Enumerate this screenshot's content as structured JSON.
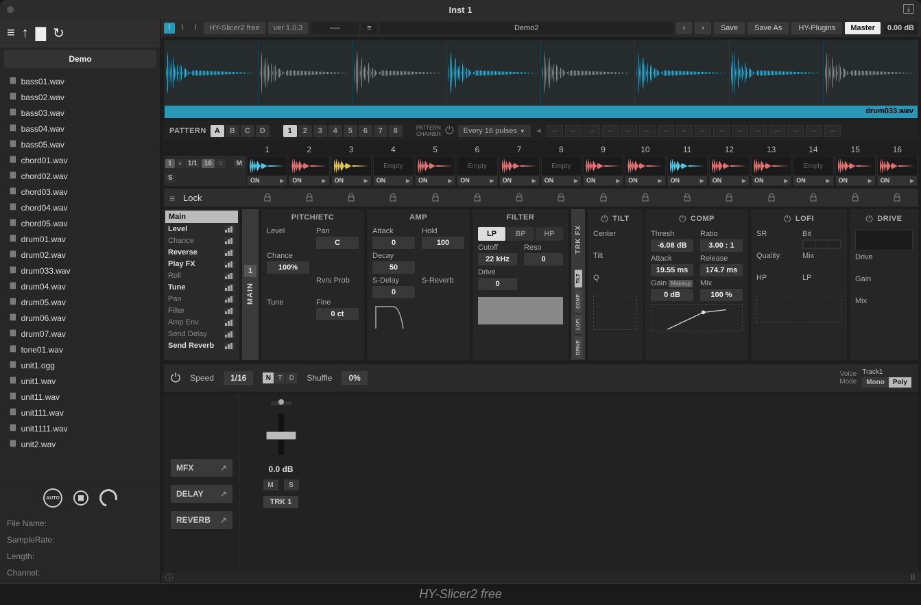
{
  "window": {
    "title": "Inst 1"
  },
  "toolbar": {
    "plugin_name": "HY-Slicer2 free",
    "version": "ver 1.0.3",
    "dashes": "----",
    "preset": "Demo2",
    "save": "Save",
    "save_as": "Save As",
    "vendor": "HY-Plugins",
    "master": "Master",
    "master_db": "0.00 dB"
  },
  "sidebar": {
    "demo_label": "Demo",
    "files": [
      "bass01.wav",
      "bass02.wav",
      "bass03.wav",
      "bass04.wav",
      "bass05.wav",
      "chord01.wav",
      "chord02.wav",
      "chord03.wav",
      "chord04.wav",
      "chord05.wav",
      "drum01.wav",
      "drum02.wav",
      "drum033.wav",
      "drum04.wav",
      "drum05.wav",
      "drum06.wav",
      "drum07.wav",
      "tone01.wav",
      "unit1.ogg",
      "unit1.wav",
      "unit11.wav",
      "unit111.wav",
      "unit1111.wav",
      "unit2.wav"
    ],
    "auto": "AUTO",
    "info": {
      "filename": "File Name:",
      "samplerate": "SampleRate:",
      "length": "Length:",
      "channel": "Channel:"
    }
  },
  "waveform": {
    "filename": "drum033.wav"
  },
  "pattern": {
    "label": "PATTERN",
    "banks": [
      "A",
      "B",
      "C",
      "D"
    ],
    "active_bank": "A",
    "slots": [
      "1",
      "2",
      "3",
      "4",
      "5",
      "6",
      "7",
      "8"
    ],
    "active_slot": "1",
    "chainer_label1": "PATTERN",
    "chainer_label2": "CHAINER",
    "pulses": "Every 16 pulses",
    "chain_empty": "--"
  },
  "slices": {
    "nums": [
      "1",
      "2",
      "3",
      "4",
      "5",
      "6",
      "7",
      "8",
      "9",
      "10",
      "11",
      "12",
      "13",
      "14",
      "15",
      "16"
    ],
    "ctrl": {
      "one": "1",
      "frac": "1/1",
      "sixteen": "16",
      "m": "M",
      "s": "S"
    },
    "cells": [
      {
        "color": "c-blue",
        "empty": false
      },
      {
        "color": "c-red",
        "empty": false
      },
      {
        "color": "c-yellow",
        "empty": false
      },
      {
        "color": "",
        "empty": true
      },
      {
        "color": "c-red",
        "empty": false
      },
      {
        "color": "",
        "empty": true
      },
      {
        "color": "c-red",
        "empty": false
      },
      {
        "color": "",
        "empty": true
      },
      {
        "color": "c-red",
        "empty": false
      },
      {
        "color": "c-red",
        "empty": false
      },
      {
        "color": "c-blue",
        "empty": false
      },
      {
        "color": "c-red",
        "empty": false
      },
      {
        "color": "c-red",
        "empty": false
      },
      {
        "color": "",
        "empty": true
      },
      {
        "color": "c-red",
        "empty": false
      },
      {
        "color": "c-red",
        "empty": false
      }
    ],
    "empty_text": "Empty",
    "on_text": "ON"
  },
  "lock": {
    "label": "Lock"
  },
  "param_side": {
    "items": [
      {
        "name": "Main",
        "active": true,
        "bold": true,
        "bars": false
      },
      {
        "name": "Level",
        "active": false,
        "bold": true,
        "bars": true
      },
      {
        "name": "Chance",
        "active": false,
        "bold": false,
        "bars": true
      },
      {
        "name": "Reverse",
        "active": false,
        "bold": true,
        "bars": true
      },
      {
        "name": "Play FX",
        "active": false,
        "bold": true,
        "bars": true
      },
      {
        "name": "Roll",
        "active": false,
        "bold": false,
        "bars": true
      },
      {
        "name": "Tune",
        "active": false,
        "bold": true,
        "bars": true
      },
      {
        "name": "Pan",
        "active": false,
        "bold": false,
        "bars": true
      },
      {
        "name": "Filter",
        "active": false,
        "bold": false,
        "bars": true
      },
      {
        "name": "Amp Env",
        "active": false,
        "bold": false,
        "bars": true
      },
      {
        "name": "Send Delay",
        "active": false,
        "bold": false,
        "bars": true
      },
      {
        "name": "Send Reverb",
        "active": false,
        "bold": true,
        "bars": true
      }
    ]
  },
  "main_tab": {
    "num": "1",
    "label": "MAIN"
  },
  "sections": {
    "pitch": {
      "title": "PITCH/ETC",
      "level": "Level",
      "pan": "Pan",
      "pan_v": "C",
      "chance": "Chance",
      "chance_v": "100%",
      "rvrs": "Rvrs Prob",
      "tune": "Tune",
      "fine": "Fine",
      "fine_v": "0 ct"
    },
    "amp": {
      "title": "AMP",
      "attack": "Attack",
      "attack_v": "0",
      "hold": "Hold",
      "hold_v": "100",
      "decay": "Decay",
      "decay_v": "50",
      "sdelay": "S-Delay",
      "sdelay_v": "0",
      "sreverb": "S-Reverb"
    },
    "filter": {
      "title": "FILTER",
      "lp": "LP",
      "bp": "BP",
      "hp": "HP",
      "cutoff": "Cutoff",
      "cutoff_v": "22 kHz",
      "reso": "Reso",
      "reso_v": "0",
      "drive": "Drive",
      "drive_v": "0"
    },
    "trkfx": "TRK FX",
    "fx_tabs": [
      "TILT",
      "COMP",
      "LOFI",
      "DRIVE"
    ],
    "tilt": {
      "title": "TILT",
      "center": "Center",
      "tilt": "Tilt",
      "q": "Q"
    },
    "comp": {
      "title": "COMP",
      "thresh": "Thresh",
      "thresh_v": "-6.08 dB",
      "ratio": "Ratio",
      "ratio_v": "3.00  :  1",
      "attack": "Attack",
      "attack_v": "19.55 ms",
      "release": "Release",
      "release_v": "174.7 ms",
      "gain": "Gain",
      "makeup": "Makeup",
      "gain_v": "0 dB",
      "mix": "Mix",
      "mix_v": "100 %"
    },
    "lofi": {
      "title": "LOFI",
      "sr": "SR",
      "bit": "Bit",
      "quality": "Quality",
      "mix": "Mix",
      "hp": "HP",
      "lp": "LP"
    },
    "drive2": {
      "title": "DRIVE",
      "drive": "Drive",
      "gain": "Gain",
      "mix": "Mix"
    }
  },
  "bottom": {
    "speed": "Speed",
    "speed_v": "1/16",
    "ntd": [
      "N",
      "T",
      "D"
    ],
    "shuffle": "Shuffle",
    "shuffle_v": "0%",
    "voice1": "Voice",
    "voice2": "Mode",
    "track": "Track1",
    "mono": "Mono",
    "poly": "Poly"
  },
  "mixer": {
    "mfx": "MFX",
    "delay": "DELAY",
    "reverb": "REVERB",
    "db": "0.0 dB",
    "m": "M",
    "s": "S",
    "trk": "TRK 1"
  },
  "footer": {
    "text": "HY-Slicer2 free"
  }
}
